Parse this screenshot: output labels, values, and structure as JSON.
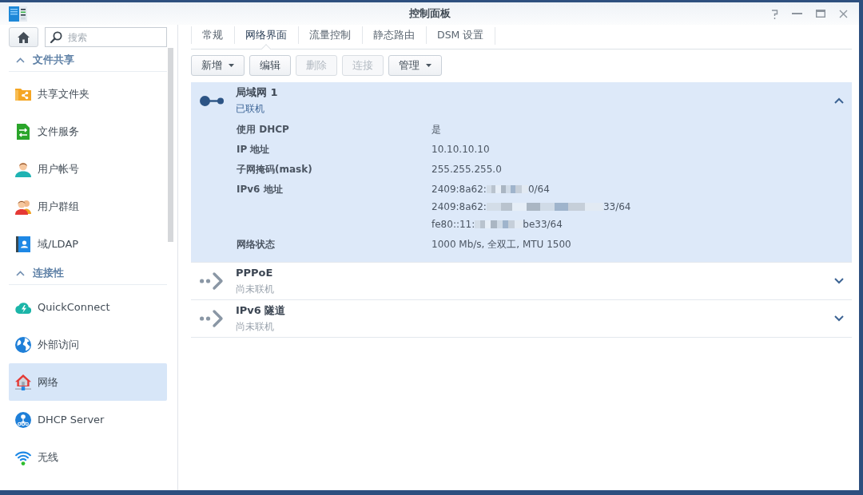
{
  "window": {
    "title": "控制面板"
  },
  "sidebar": {
    "search": {
      "placeholder": "搜索"
    },
    "sections": [
      {
        "title": "文件共享",
        "expanded": true,
        "items": [
          {
            "label": "共享文件夹",
            "selected": false
          },
          {
            "label": "文件服务",
            "selected": false
          },
          {
            "label": "用户帐号",
            "selected": false
          },
          {
            "label": "用户群组",
            "selected": false
          },
          {
            "label": "域/LDAP",
            "selected": false
          }
        ]
      },
      {
        "title": "连接性",
        "expanded": true,
        "items": [
          {
            "label": "QuickConnect",
            "selected": false
          },
          {
            "label": "外部访问",
            "selected": false
          },
          {
            "label": "网络",
            "selected": true
          },
          {
            "label": "DHCP Server",
            "selected": false
          },
          {
            "label": "无线",
            "selected": false
          }
        ]
      }
    ]
  },
  "tabs": [
    {
      "label": "常规",
      "selected": false
    },
    {
      "label": "网络界面",
      "selected": true
    },
    {
      "label": "流量控制",
      "selected": false
    },
    {
      "label": "静态路由",
      "selected": false
    },
    {
      "label": "DSM 设置",
      "selected": false
    }
  ],
  "toolbar": [
    {
      "label": "新增",
      "menu": true,
      "disabled": false
    },
    {
      "label": "编辑",
      "menu": false,
      "disabled": false
    },
    {
      "label": "删除",
      "menu": false,
      "disabled": true
    },
    {
      "label": "连接",
      "menu": false,
      "disabled": true
    },
    {
      "label": "管理",
      "menu": true,
      "disabled": false
    }
  ],
  "interfaces": [
    {
      "name": "局域网 1",
      "status": "已联机",
      "connected": true,
      "expanded": true,
      "details": [
        {
          "label": "使用 DHCP",
          "values": [
            {
              "text": "是"
            }
          ]
        },
        {
          "label": "IP 地址",
          "values": [
            {
              "text": "10.10.10.10"
            }
          ]
        },
        {
          "label": "子网掩码(mask)",
          "values": [
            {
              "text": "255.255.255.0"
            }
          ]
        },
        {
          "label": "IPv6 地址",
          "values": [
            {
              "text": "2409:8a62:",
              "blurred": true,
              "rest": "0/64"
            },
            {
              "text": "2409:8a62:",
              "blurred": true,
              "rest": "33/64"
            },
            {
              "text": "fe80::11:",
              "blurred": true,
              "rest": "be33/64"
            }
          ]
        },
        {
          "label": "网络状态",
          "values": [
            {
              "text": "1000 Mb/s, 全双工, MTU 1500"
            }
          ]
        }
      ]
    },
    {
      "name": "PPPoE",
      "status": "尚未联机",
      "connected": false,
      "expanded": false
    },
    {
      "name": "IPv6 隧道",
      "status": "尚未联机",
      "connected": false,
      "expanded": false
    }
  ]
}
